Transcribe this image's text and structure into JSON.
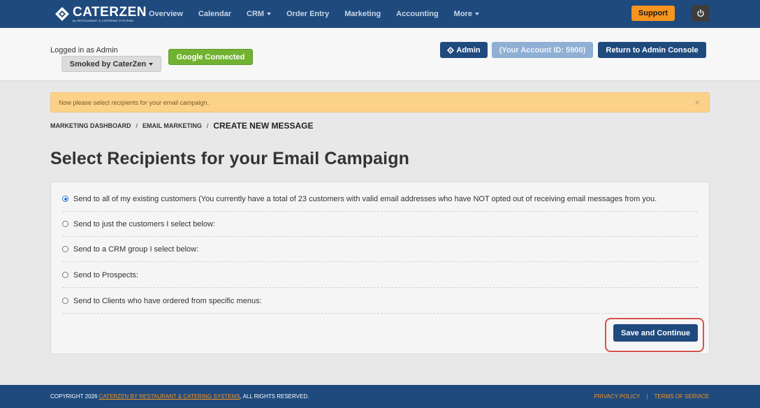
{
  "brand": {
    "name": "CATERZEN",
    "tagline": "by RESTAURANT & CATERING SYSTEMS"
  },
  "nav": {
    "items": [
      {
        "label": "Overview"
      },
      {
        "label": "Calendar"
      },
      {
        "label": "CRM"
      },
      {
        "label": "Order Entry"
      },
      {
        "label": "Marketing"
      },
      {
        "label": "Accounting"
      },
      {
        "label": "More"
      }
    ],
    "support_label": "Support"
  },
  "header": {
    "logged_in_text": "Logged in as Admin",
    "account_selector": "Smoked by CaterZen",
    "google_status": "Google Connected",
    "admin_label": "Admin",
    "account_id_label": "(Your Account ID: 5900)",
    "return_label": "Return to Admin Console"
  },
  "alert": {
    "message": "Now please select recipients for your email campaign.",
    "close_symbol": "×"
  },
  "breadcrumb": {
    "items": [
      "MARKETING DASHBOARD",
      "EMAIL MARKETING"
    ],
    "separator": "/",
    "current": "CREATE NEW MESSAGE"
  },
  "page": {
    "title": "Select Recipients for your Email Campaign"
  },
  "recipients": {
    "options": [
      {
        "label": "Send to all of my existing customers (You currently have a total of 23 customers with valid email addresses who have NOT opted out of receiving email messages from you.",
        "selected": true
      },
      {
        "label": "Send to just the customers I select below:",
        "selected": false
      },
      {
        "label": "Send to a CRM group I select below:",
        "selected": false
      },
      {
        "label": "Send to Prospects:",
        "selected": false
      },
      {
        "label": "Send to Clients who have ordered from specific menus:",
        "selected": false
      }
    ],
    "save_label": "Save and Continue"
  },
  "footer": {
    "copyright_prefix": "COPYRIGHT 2026 ",
    "copyright_link": "CATERZEN BY RESTAURANT & CATERING SYSTEMS",
    "copyright_suffix": ", ALL RIGHTS RESERVED.",
    "privacy_label": "PRIVACY POLICY",
    "terms_label": "TERMS OF SERVICE"
  },
  "colors": {
    "nav_bg": "#1f4a7e",
    "support": "#f7941d",
    "google": "#72b233",
    "alert_bg": "#fcd28a",
    "highlight_outline": "#d5534a"
  }
}
